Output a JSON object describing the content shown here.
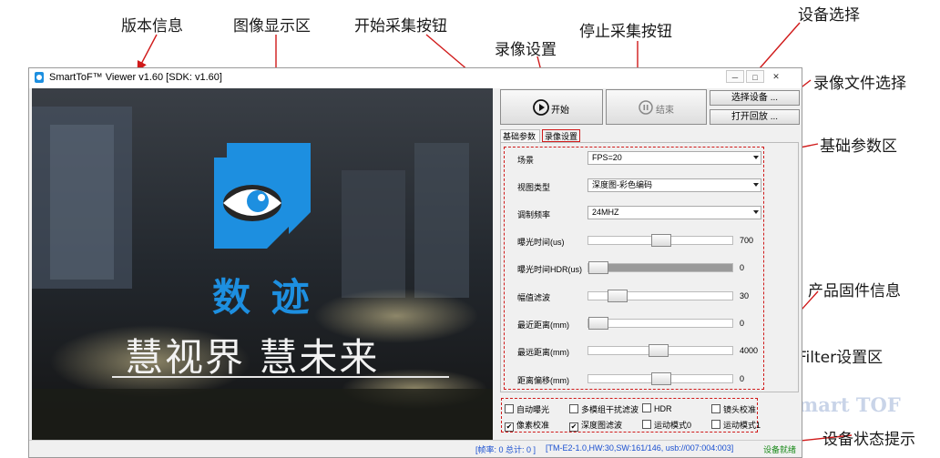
{
  "annotations": {
    "version": "版本信息",
    "display": "图像显示区",
    "start": "开始采集按钮",
    "record": "录像设置",
    "stop": "停止采集按钮",
    "device_select": "设备选择",
    "record_file": "录像文件选择",
    "basic_params": "基础参数区",
    "firmware": "产品固件信息",
    "filter": "Filter设置区",
    "device_status": "设备状态提示"
  },
  "window": {
    "title": "SmartToF™ Viewer v1.60 [SDK: v1.60]",
    "min": "─",
    "max": "□",
    "close": "✕"
  },
  "display": {
    "logo_text": "数 迹",
    "slogan": "慧视界 慧未来"
  },
  "toolbar": {
    "start_label": "开始",
    "stop_label": "结束",
    "select_device_label": "选择设备 ...",
    "open_replay_label": "打开回放 ..."
  },
  "tabs": [
    "基础参数",
    "录像设置"
  ],
  "params": {
    "scene_label": "场景",
    "scene_value": "FPS=20",
    "view_label": "视图类型",
    "view_value": "深度图-彩色编码",
    "freq_label": "调制频率",
    "freq_value": "24MHZ",
    "sliders": [
      {
        "label": "曝光时间(us)",
        "value": "700",
        "level": 0.5
      },
      {
        "label": "曝光时间HDR(us)",
        "value": "0",
        "level": 0.0
      },
      {
        "label": "幅值滤波",
        "value": "30",
        "level": 0.15
      },
      {
        "label": "最近距离(mm)",
        "value": "0",
        "level": 0.0
      },
      {
        "label": "最远距离(mm)",
        "value": "4000",
        "level": 0.48
      },
      {
        "label": "距离偏移(mm)",
        "value": "0",
        "level": 0.5
      }
    ]
  },
  "filters": {
    "row1": [
      {
        "label": "自动曝光",
        "checked": false
      },
      {
        "label": "多模组干扰滤波",
        "checked": false
      },
      {
        "label": "HDR",
        "checked": false
      },
      {
        "label": "镜头校准",
        "checked": false
      }
    ],
    "row2": [
      {
        "label": "像素校准",
        "checked": true
      },
      {
        "label": "深度图滤波",
        "checked": true
      },
      {
        "label": "运动模式0",
        "checked": false
      },
      {
        "label": "运动模式1",
        "checked": false
      }
    ]
  },
  "status": {
    "frames": "[帧率: 0 总计: 0 ]",
    "firmware": "[TM-E2-1.0,HW:30,SW:161/146, usb://007:004:003]",
    "ready": "设备就绪"
  },
  "watermark": "mart TOF",
  "colors": {
    "annotation_line": "#d01a1a",
    "status_blue": "#1a4fd0",
    "status_green": "#1a8a1a",
    "logo_blue": "#1d8fe0"
  }
}
